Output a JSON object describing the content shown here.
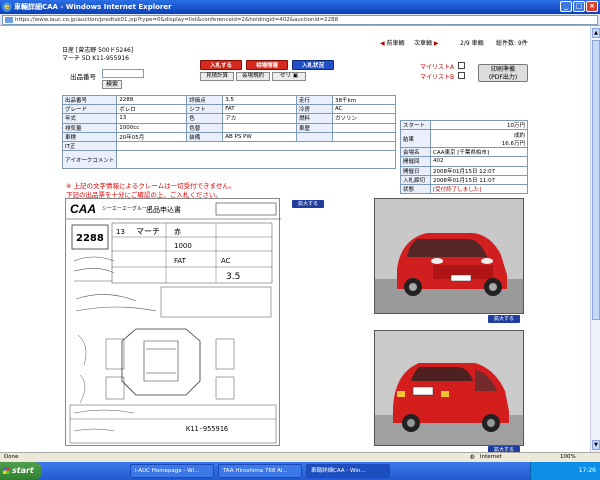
{
  "window": {
    "title": "車輛詳細CAA - Windows Internet Explorer",
    "address": "https://www.iauc.co.jp/auction/predtsk01.jsp?type=0&display=list&conferenceid=2&holdingid=402&auctionid=2288"
  },
  "nav": {
    "prev": "前車輌",
    "next": "次車輌",
    "page": "2/9 車輌",
    "total": "総件数: 9件"
  },
  "car": {
    "line1": "日産 [曾志野 500ド5246]",
    "line2": "マーチ 5D K11-955916"
  },
  "buttons": {
    "bid": "入札する",
    "market": "相場情報",
    "status": "入札状況",
    "estimate": "見積計算",
    "venue_rules": "会場規約",
    "seri": "セリ",
    "print": "印刷準備",
    "print_sub": "(PDF出力)",
    "search": "検索",
    "zoom": "拡大する"
  },
  "mylist": {
    "a": "マイリストA",
    "b": "マイリストB"
  },
  "lot_label": "出品番号",
  "specs": [
    [
      "出品番号",
      "2288",
      "評価点",
      "3.5",
      "走行",
      "38千km"
    ],
    [
      "グレード",
      "ボレロ",
      "シフト",
      "FAT",
      "冷房",
      "AC"
    ],
    [
      "年式",
      "13",
      "色",
      "アカ",
      "燃料",
      "ガソリン"
    ],
    [
      "排気量",
      "1000cc",
      "色替",
      "",
      "車歴",
      ""
    ],
    [
      "車検",
      "20年05月",
      "装備",
      "AB PS PW",
      "",
      ""
    ]
  ],
  "spec_misc": {
    "mark": "IT正",
    "comment": "アイオークコメント"
  },
  "side": [
    [
      "スタート",
      "10万円"
    ],
    [
      "結果",
      "成約\n16.6万円"
    ],
    [
      "会場名",
      "CAA東京 [千葉県柏市]"
    ],
    [
      "開催回",
      "402"
    ],
    [
      "開催日",
      "2008年01月15日 12:07"
    ],
    [
      "入札締切",
      "2008年01月15日 11:07"
    ],
    [
      "状態",
      "[受付終了しました]"
    ]
  ],
  "notice": {
    "line1": "※ 上記の文字情報によるクレームは一切受付できません。",
    "line2": "下記の出品票を十分にご確認の上、ご入札ください。"
  },
  "sheet": {
    "logo": "CAA",
    "company": "シーエーエーグループ",
    "heading": "出品申込書",
    "lot": "2288",
    "model": "マーチ",
    "chassis": "K11-955916",
    "year": "13",
    "body_color": "赤",
    "cc": "1000",
    "shift": "FAT",
    "ac": "AC",
    "points": "3.5"
  },
  "status": {
    "left": "Done",
    "zone": "Internet",
    "zoom": "100%"
  },
  "taskbar": {
    "start": "start",
    "tasks": [
      "i-AUC Homepage - Wi...",
      "TAA Hiroshima 768 Al...",
      "車輌詳細CAA - Win..."
    ],
    "clock": "17:26"
  }
}
